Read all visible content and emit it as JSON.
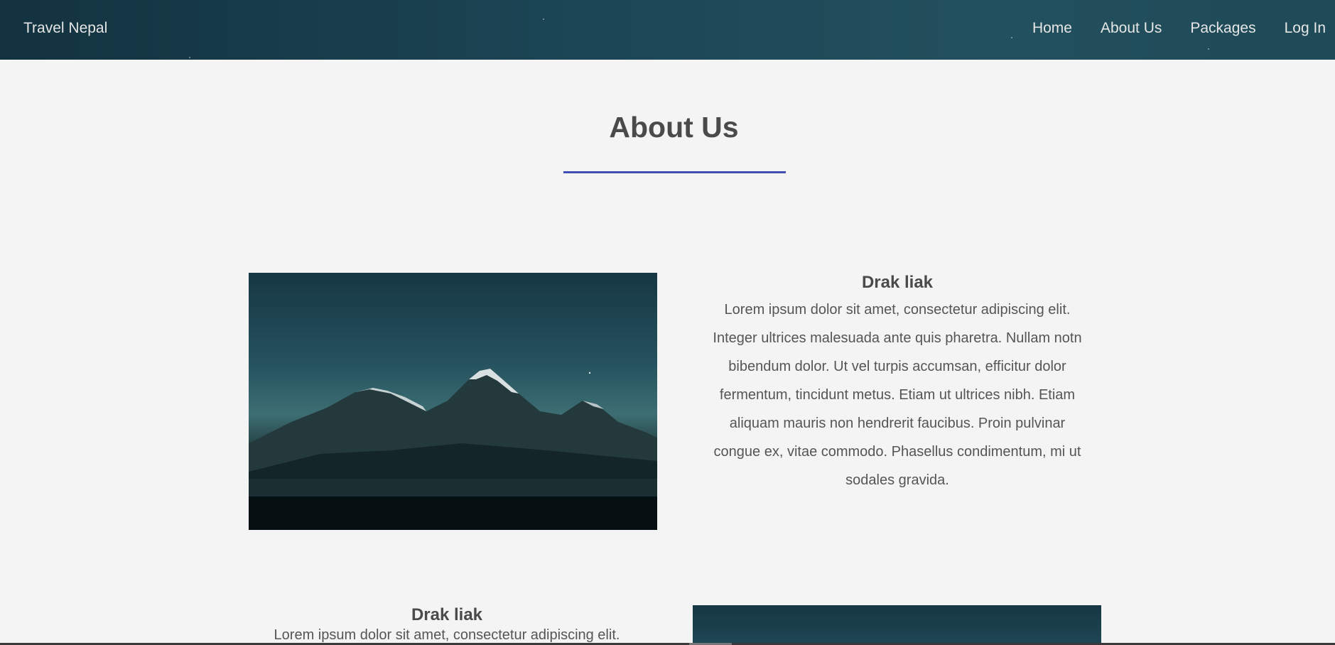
{
  "header": {
    "brand": "Travel Nepal",
    "nav": [
      "Home",
      "About Us",
      "Packages",
      "Log In"
    ]
  },
  "main": {
    "title": "About Us",
    "accent_color": "#3f4fb5",
    "cards": [
      {
        "heading": "Drak liak",
        "body": "Lorem ipsum dolor sit amet, consectetur adipiscing elit. Integer ultrices malesuada ante quis pharetra. Nullam notn bibendum dolor. Ut vel turpis accumsan, efficitur dolor fermentum, tincidunt metus. Etiam ut ultrices nibh. Etiam aliquam mauris non hendrerit faucibus. Proin pulvinar congue ex, vitae commodo. Phasellus condimentum, mi ut sodales gravida."
      },
      {
        "heading": "Drak liak",
        "body": "Lorem ipsum dolor sit amet, consectetur adipiscing elit."
      }
    ]
  }
}
